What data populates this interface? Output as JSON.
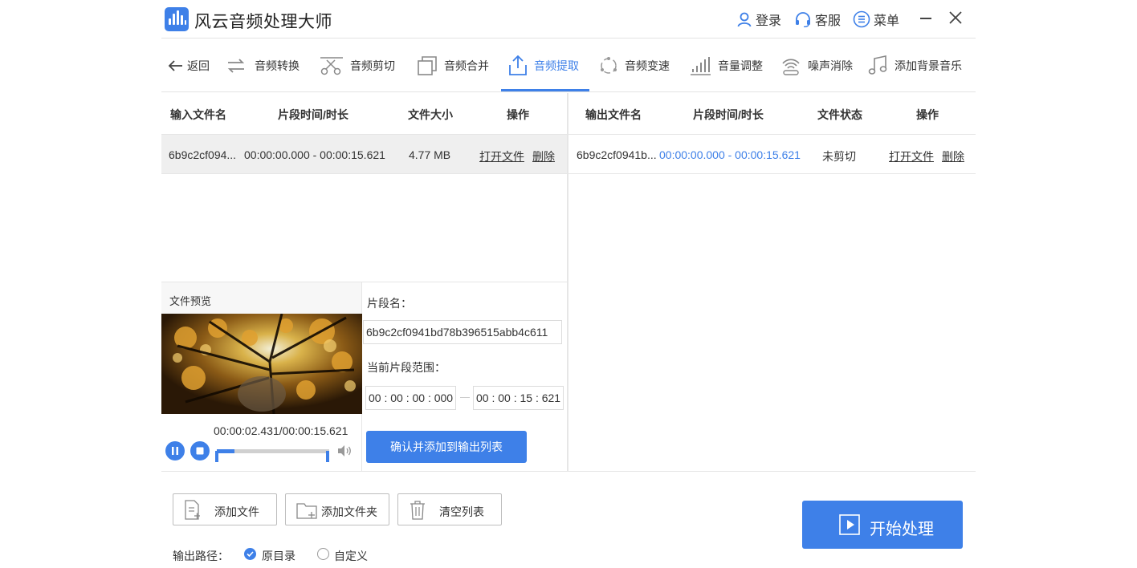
{
  "app": {
    "title": "风云音频处理大师",
    "accent_color": "#3e80e8"
  },
  "titlebar": {
    "login_label": "登录",
    "service_label": "客服",
    "menu_label": "菜单"
  },
  "toolbar": {
    "back_label": "返回",
    "items": [
      {
        "label": "音频转换",
        "icon": "convert-icon"
      },
      {
        "label": "音频剪切",
        "icon": "scissors-icon"
      },
      {
        "label": "音频合并",
        "icon": "merge-icon"
      },
      {
        "label": "音频提取",
        "icon": "extract-icon",
        "active": true
      },
      {
        "label": "音频变速",
        "icon": "speed-icon"
      },
      {
        "label": "音量调整",
        "icon": "volume-bars-icon"
      },
      {
        "label": "噪声消除",
        "icon": "noise-icon"
      },
      {
        "label": "添加背景音乐",
        "icon": "music-note-icon"
      }
    ]
  },
  "input_table": {
    "headers": [
      "输入文件名",
      "片段时间/时长",
      "文件大小",
      "操作"
    ],
    "rows": [
      {
        "filename": "6b9c2cf094...",
        "time_range": "00:00:00.000 - 00:00:15.621",
        "size": "4.77 MB",
        "open_label": "打开文件",
        "delete_label": "删除"
      }
    ]
  },
  "output_table": {
    "headers": [
      "输出文件名",
      "片段时间/时长",
      "文件状态",
      "操作"
    ],
    "rows": [
      {
        "filename": "6b9c2cf0941b...",
        "time_range": "00:00:00.000 - 00:00:15.621",
        "status": "未剪切",
        "open_label": "打开文件",
        "delete_label": "删除"
      }
    ]
  },
  "preview": {
    "title": "文件预览",
    "time_readout": "00:00:02.431/00:00:15.621",
    "progress": 0.16
  },
  "clip": {
    "name_label": "片段名：",
    "name_value": "6b9c2cf0941bd78b396515abb4c611",
    "range_label": "当前片段范围：",
    "start_value": "00 : 00 : 00 : 000",
    "end_value": "00 : 00 : 15 : 621",
    "confirm_label": "确认并添加到输出列表"
  },
  "bottom": {
    "add_file_label": "添加文件",
    "add_folder_label": "添加文件夹",
    "clear_list_label": "清空列表",
    "output_path_label": "输出路径：",
    "radio_original_label": "原目录",
    "radio_custom_label": "自定义",
    "selected_output": "原目录",
    "start_label": "开始处理"
  }
}
